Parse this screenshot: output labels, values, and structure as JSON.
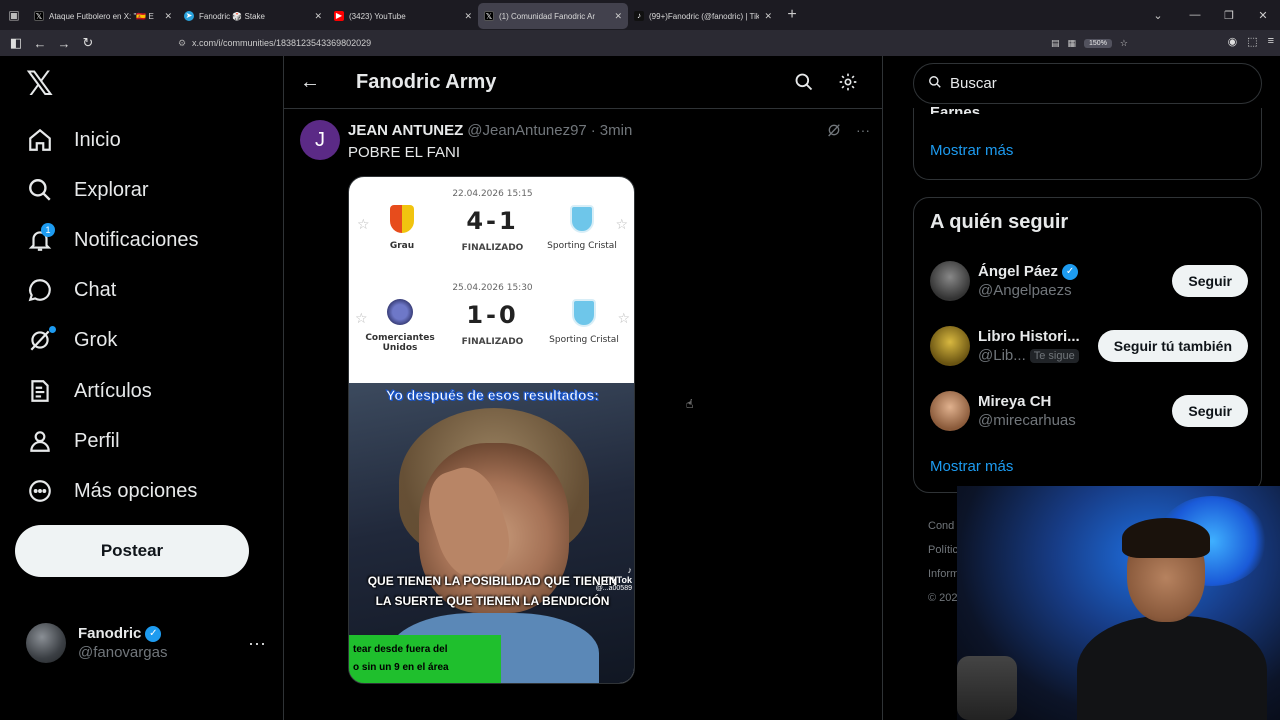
{
  "browser": {
    "tabs": [
      {
        "title": "Ataque Futbolero en X: \"🇪🇸 E",
        "favicon": "x-icon",
        "color": "#000000",
        "active": false
      },
      {
        "title": "Fanodric 🎲 Stake",
        "favicon": "telegram-icon",
        "color": "#2aa3dd",
        "active": false
      },
      {
        "title": "(3423) YouTube",
        "favicon": "youtube-icon",
        "color": "#ff0000",
        "active": false
      },
      {
        "title": "(1) Comunidad Fanodric Ar",
        "favicon": "x-icon",
        "color": "#000000",
        "active": true
      },
      {
        "title": "(99+)Fanodric (@fanodric) | Tik",
        "favicon": "tiktok-icon",
        "color": "#111111",
        "active": false
      }
    ],
    "url": "x.com/i/communities/1838123543369802029",
    "zoom": "150%"
  },
  "sidebar": {
    "items": [
      {
        "label": "Inicio",
        "icon": "home-icon"
      },
      {
        "label": "Explorar",
        "icon": "search-icon"
      },
      {
        "label": "Notificaciones",
        "icon": "bell-icon",
        "badge": "1"
      },
      {
        "label": "Chat",
        "icon": "chat-icon"
      },
      {
        "label": "Grok",
        "icon": "grok-icon"
      },
      {
        "label": "Artículos",
        "icon": "article-icon"
      },
      {
        "label": "Perfil",
        "icon": "person-icon"
      },
      {
        "label": "Más opciones",
        "icon": "more-circle-icon"
      }
    ],
    "post_label": "Postear",
    "account": {
      "name": "Fanodric",
      "handle": "@fanovargas"
    }
  },
  "main": {
    "title": "Fanodric Army",
    "post": {
      "avatar_letter": "J",
      "author": "JEAN ANTUNEZ",
      "handle": "@JeanAntunez97",
      "separator": "·",
      "time": "3min",
      "text": "POBRE EL FANI",
      "matches": [
        {
          "date": "22.04.2026 15:15",
          "home": "Grau",
          "away": "Sporting Cristal",
          "score": "4-1",
          "status": "FINALIZADO"
        },
        {
          "date": "25.04.2026 15:30",
          "home": "Comerciantes Unidos",
          "away": "Sporting Cristal",
          "score": "1-0",
          "status": "FINALIZADO"
        }
      ],
      "meme": {
        "caption_top": "Yo después de esos resultados:",
        "caption_bottom": "QUE TIENEN LA POSIBILIDAD QUE TIENEN LA SUERTE QUE TIENEN LA BENDICIÓN",
        "tiktok_brand": "TikTok",
        "tiktok_id": "@...a00589",
        "green_line1": "tear desde fuera del",
        "green_line2": "o sin un 9 en el área"
      }
    }
  },
  "right": {
    "search_placeholder": "Buscar",
    "top_box_peek": "Earnes",
    "show_more": "Mostrar más",
    "follow_title": "A quién seguir",
    "suggestions": [
      {
        "name": "Ángel Páez",
        "handle": "@Angelpaezs",
        "verified": true,
        "follows_you": false,
        "button": "Seguir"
      },
      {
        "name": "Libro Histori...",
        "handle": "@Lib...",
        "verified": false,
        "follows_you": true,
        "follows_you_label": "Te sigue",
        "button": "Seguir tú también"
      },
      {
        "name": "Mireya CH",
        "handle": "@mirecarhuas",
        "verified": false,
        "follows_you": false,
        "button": "Seguir"
      }
    ],
    "show_more_2": "Mostrar más",
    "footer": [
      "Cond",
      "Polític",
      "Inform",
      "© 202"
    ]
  },
  "colors": {
    "accent": "#1d9bf0",
    "background": "#000000",
    "border": "#2f3336",
    "muted": "#71767b"
  }
}
